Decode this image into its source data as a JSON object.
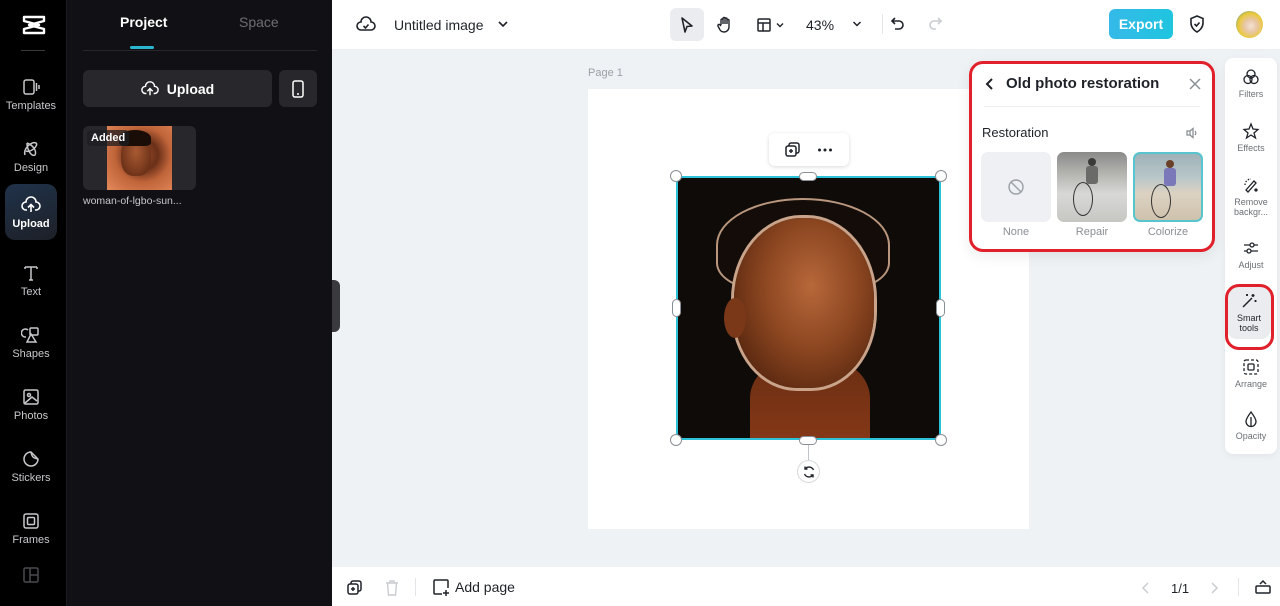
{
  "rail": {
    "items": [
      {
        "label": "Templates",
        "icon": "templates-icon"
      },
      {
        "label": "Design",
        "icon": "design-icon"
      },
      {
        "label": "Upload",
        "icon": "upload-cloud-icon",
        "active": true
      },
      {
        "label": "Text",
        "icon": "text-icon"
      },
      {
        "label": "Shapes",
        "icon": "shapes-icon"
      },
      {
        "label": "Photos",
        "icon": "photos-icon"
      },
      {
        "label": "Stickers",
        "icon": "stickers-icon"
      },
      {
        "label": "Frames",
        "icon": "frames-icon"
      }
    ]
  },
  "panel": {
    "tabs": [
      {
        "label": "Project",
        "active": true
      },
      {
        "label": "Space"
      }
    ],
    "upload_label": "Upload",
    "assets": [
      {
        "name": "woman-of-lgbo-sun...",
        "badge": "Added"
      }
    ]
  },
  "topbar": {
    "title": "Untitled image",
    "zoom": "43%",
    "export_label": "Export"
  },
  "canvas": {
    "page_label": "Page 1"
  },
  "popover": {
    "title": "Old photo restoration",
    "section": "Restoration",
    "options": [
      {
        "label": "None"
      },
      {
        "label": "Repair"
      },
      {
        "label": "Colorize",
        "selected": true
      }
    ]
  },
  "right_toolbar": {
    "items": [
      {
        "label": "Filters"
      },
      {
        "label": "Effects"
      },
      {
        "label": "Remove backgr..."
      },
      {
        "label": "Adjust"
      },
      {
        "label": "Smart tools",
        "active": true
      },
      {
        "label": "Arrange"
      },
      {
        "label": "Opacity"
      }
    ]
  },
  "bottombar": {
    "add_page_label": "Add page",
    "pager": "1/1"
  },
  "colors": {
    "accent": "#2bb6cf",
    "export": "#1fc5df",
    "highlight_ring": "#e0202a"
  }
}
